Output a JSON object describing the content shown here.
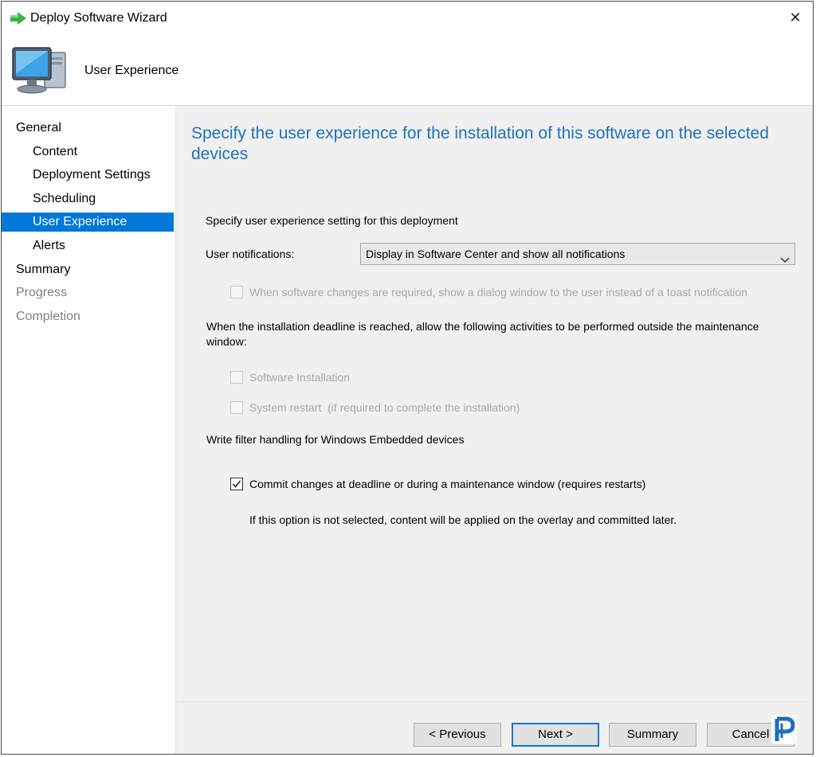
{
  "window": {
    "title": "Deploy Software Wizard"
  },
  "header": {
    "title": "User Experience"
  },
  "sidebar": {
    "items": [
      {
        "label": "General",
        "state": "normal"
      },
      {
        "label": "Content",
        "state": "normal"
      },
      {
        "label": "Deployment Settings",
        "state": "normal"
      },
      {
        "label": "Scheduling",
        "state": "normal"
      },
      {
        "label": "User Experience",
        "state": "selected"
      },
      {
        "label": "Alerts",
        "state": "normal"
      },
      {
        "label": "Summary",
        "state": "normal"
      },
      {
        "label": "Progress",
        "state": "disabled"
      },
      {
        "label": "Completion",
        "state": "disabled"
      }
    ]
  },
  "main": {
    "heading": "Specify the user experience for the installation of this software on the selected devices",
    "section_label": "Specify user experience setting for this deployment",
    "notifications_label": "User notifications:",
    "notifications_value": "Display in Software Center and show all notifications",
    "dialog_option": {
      "label": "When software changes are required, show a dialog window to the user instead of a toast notification",
      "checked": false,
      "enabled": false
    },
    "deadline_text": "When the installation deadline is reached, allow the following activities to be performed outside the maintenance window:",
    "software_install": {
      "label": "Software Installation",
      "checked": false,
      "enabled": false
    },
    "system_restart": {
      "label": "System restart  (if required to complete the installation)",
      "checked": false,
      "enabled": false
    },
    "write_filter_label": "Write filter handling for Windows Embedded devices",
    "commit_option": {
      "label": "Commit changes at deadline or during a maintenance window (requires restarts)",
      "checked": true,
      "enabled": true
    },
    "commit_note": "If this option is not selected, content will be applied on the overlay and committed later."
  },
  "footer": {
    "previous": "< Previous",
    "next": "Next >",
    "summary": "Summary",
    "cancel": "Cancel"
  },
  "colors": {
    "accent": "#0078d7",
    "heading": "#1e73be",
    "panel": "#f0f0f0"
  }
}
